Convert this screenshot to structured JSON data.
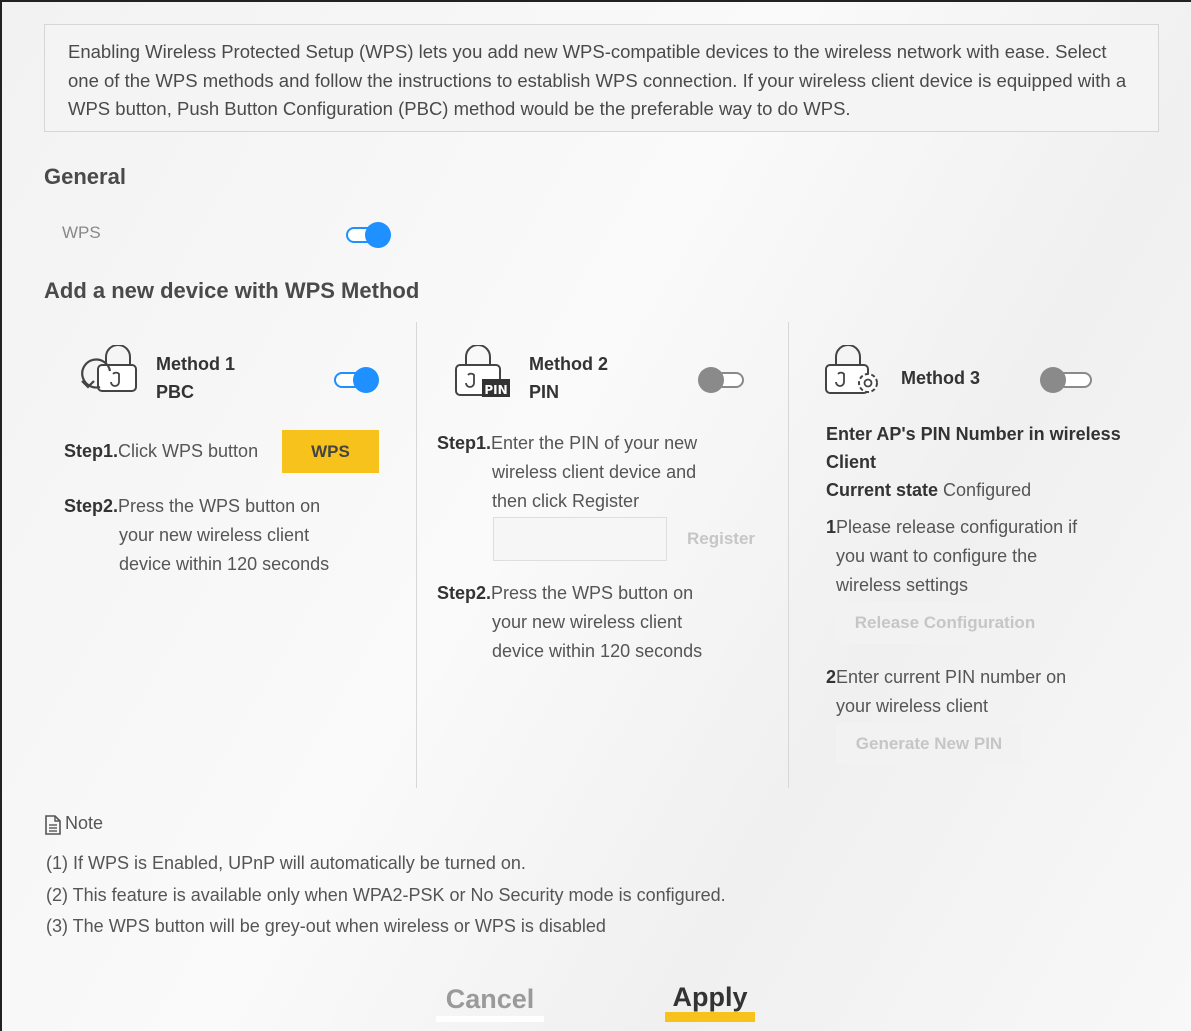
{
  "intro": {
    "text": "Enabling Wireless Protected Setup (WPS) lets you add new WPS-compatible devices to the wireless network with ease. Select one of the WPS methods and follow the instructions to establish WPS connection. If your wireless client device is equipped with a WPS button, Push Button Configuration (PBC) method would be the preferable way to do WPS."
  },
  "general": {
    "title": "General",
    "wps_label": "WPS",
    "wps_enabled": true
  },
  "add_device": {
    "title": "Add a new device with WPS Method"
  },
  "method1": {
    "name": "Method 1",
    "type": "PBC",
    "enabled": true,
    "step1_prefix": "Step1.",
    "step1_text": "Click WPS button",
    "wps_button": "WPS",
    "step2_prefix": "Step2.",
    "step2_line1": "Press the WPS button on",
    "step2_line2": "your new wireless client",
    "step2_line3": "device within 120 seconds"
  },
  "method2": {
    "name": "Method 2",
    "type": "PIN",
    "icon_badge": "PIN",
    "enabled": false,
    "step1_prefix": "Step1.",
    "step1_line1": "Enter the PIN of your new",
    "step1_line2": "wireless client device and",
    "step1_line3": "then click Register",
    "pin_value": "",
    "register_button": "Register",
    "step2_prefix": "Step2.",
    "step2_line1": "Press the WPS button on",
    "step2_line2": "your new wireless client",
    "step2_line3": "device within 120 seconds"
  },
  "method3": {
    "name": "Method 3",
    "enabled": false,
    "heading_line1": "Enter AP's PIN Number in wireless",
    "heading_line2": "Client",
    "state_label": "Current state",
    "state_value": "Configured",
    "item1_num": "1",
    "item1_line1": "Please release configuration if",
    "item1_line2": "you want to configure the",
    "item1_line3": "wireless settings",
    "release_button": "Release Configuration",
    "item2_num": "2",
    "item2_line1": "Enter current PIN number on",
    "item2_line2": "your wireless client",
    "generate_button": "Generate New PIN"
  },
  "note": {
    "label": "Note",
    "lines": [
      "(1) If WPS is Enabled, UPnP will automatically be turned on.",
      "(2) This feature is available only when WPA2-PSK or No Security mode is configured.",
      "(3) The WPS button will be grey-out when wireless or WPS is disabled"
    ]
  },
  "footer": {
    "cancel": "Cancel",
    "apply": "Apply"
  },
  "colors": {
    "toggle_on": "#1e90ff",
    "toggle_off": "#8a8a8a",
    "accent_yellow": "#f7c21b"
  }
}
